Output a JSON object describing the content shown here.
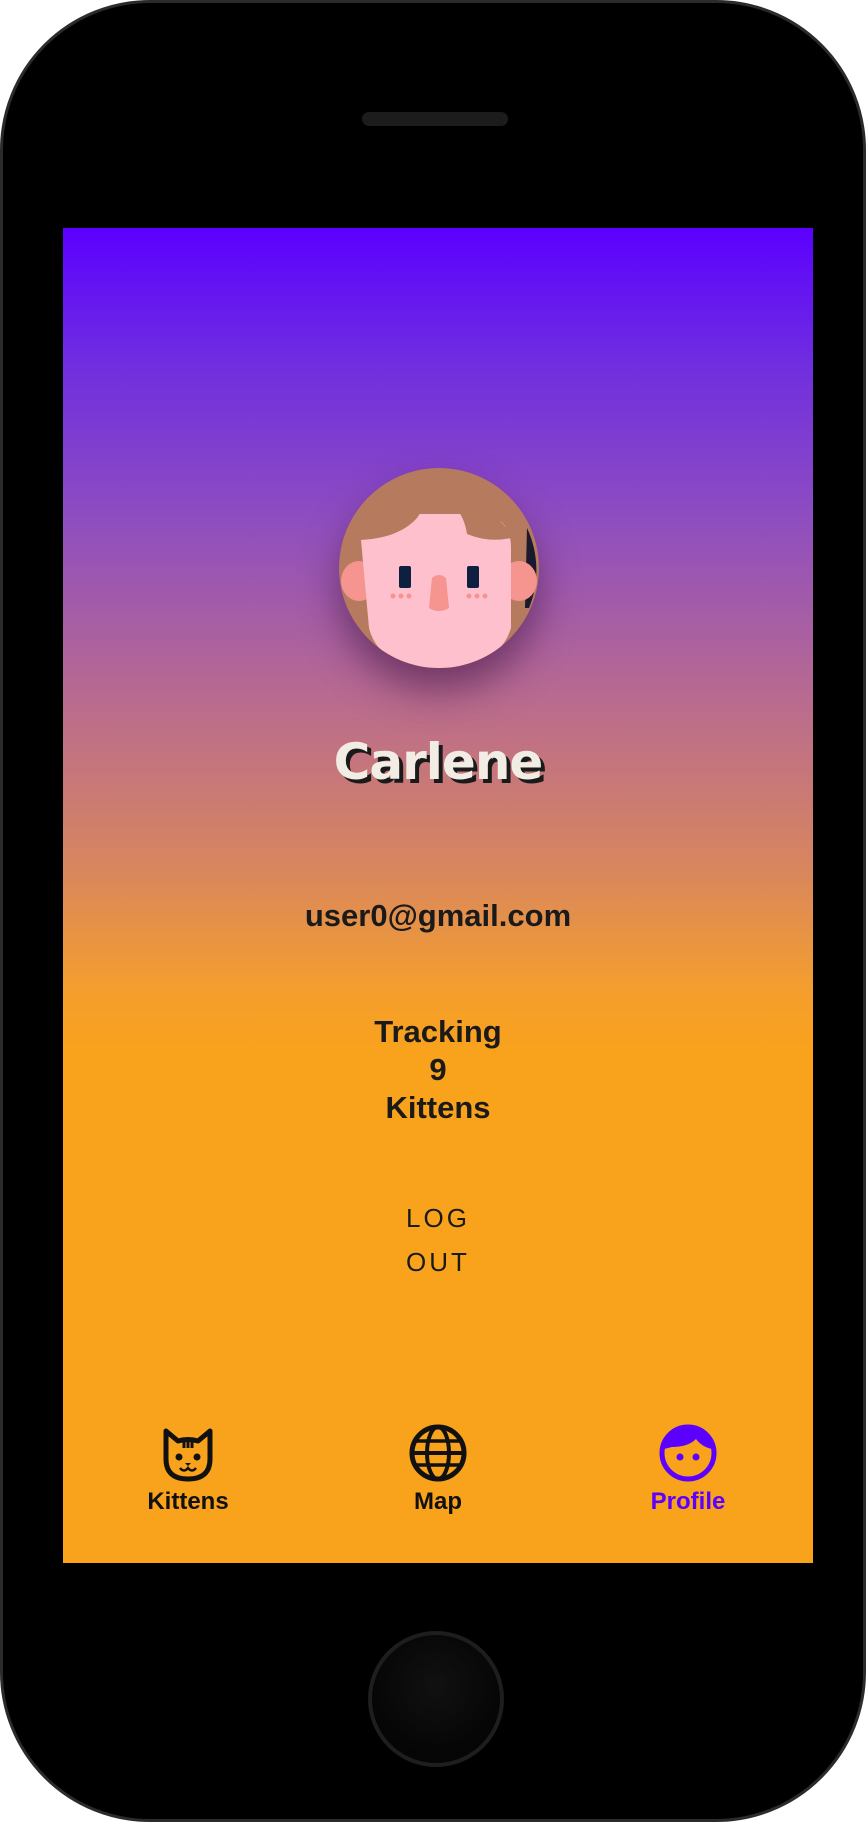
{
  "profile": {
    "name": "Carlene",
    "email": "user0@gmail.com",
    "tracking_label": "Tracking",
    "tracking_count": "9",
    "tracking_unit": "Kittens",
    "logout_label": "LOG OUT"
  },
  "tabs": [
    {
      "label": "Kittens",
      "icon": "cat-icon",
      "active": false
    },
    {
      "label": "Map",
      "icon": "globe-icon",
      "active": false
    },
    {
      "label": "Profile",
      "icon": "face-icon",
      "active": true
    }
  ],
  "colors": {
    "gradient_top": "#5b00ff",
    "gradient_bottom": "#f9a21b",
    "active_tab": "#5b00ff",
    "text": "#1a1a1a"
  }
}
